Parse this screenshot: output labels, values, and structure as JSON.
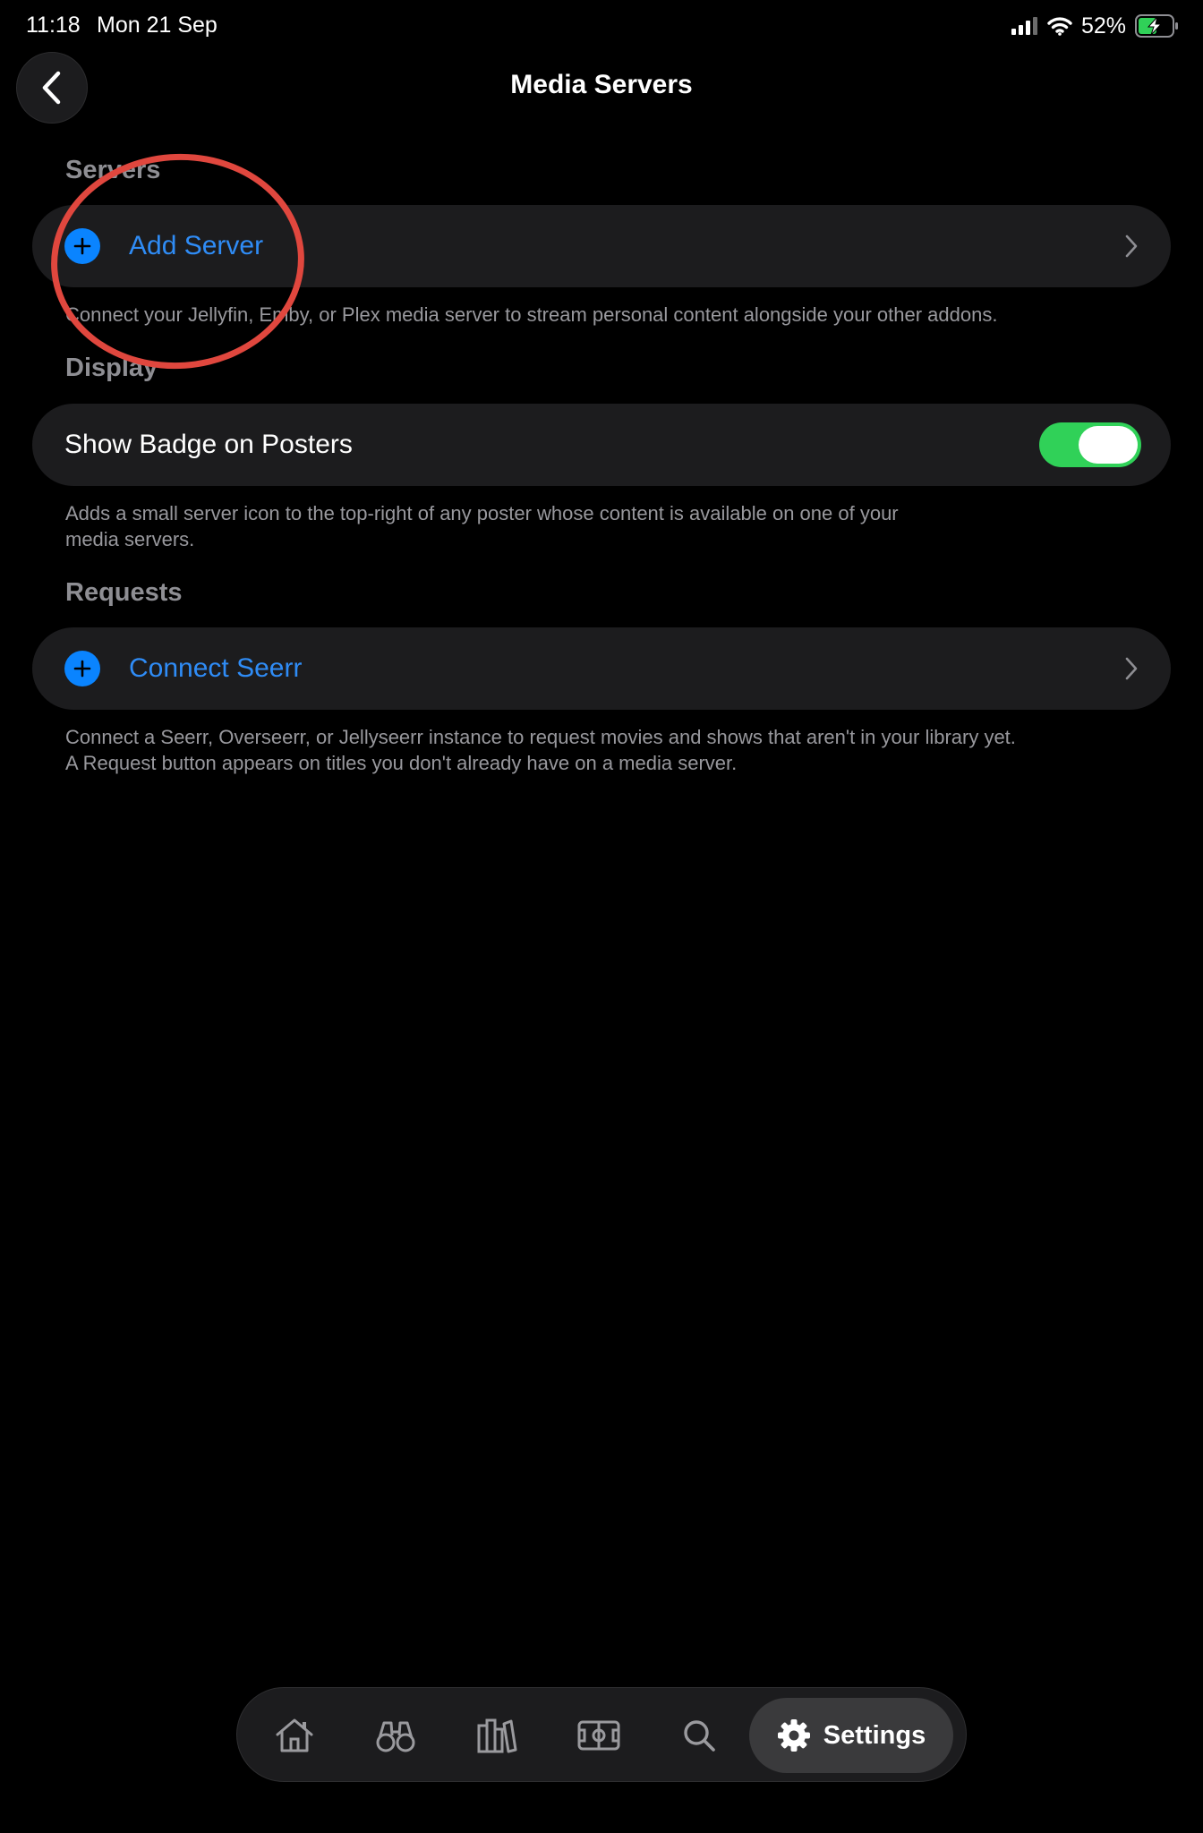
{
  "status_bar": {
    "time": "11:18",
    "date": "Mon 21 Sep",
    "battery_percent": "52%",
    "icons": [
      "cellular-signal-icon",
      "wifi-icon",
      "battery-charging-icon"
    ]
  },
  "header": {
    "back_icon": "chevron-left-icon",
    "title": "Media Servers"
  },
  "sections": {
    "servers": {
      "header": "Servers",
      "row_label": "Add Server",
      "row_icon": "plus-circle-icon",
      "description": "Connect your Jellyfin, Emby, or Plex media server to stream personal content alongside your other addons."
    },
    "display": {
      "header": "Display",
      "row_label": "Show Badge on Posters",
      "toggle_on": true,
      "description_line1": "Adds a small server icon to the top-right of any poster whose content is available on one of your",
      "description_line2": "media servers."
    },
    "requests": {
      "header": "Requests",
      "row_label": "Connect Seerr",
      "row_icon": "plus-circle-icon",
      "description_line1": "Connect a Seerr, Overseerr, or Jellyseerr instance to request movies and shows that aren't in your library yet.",
      "description_line2": "A Request button appears on titles you don't already have on a media server."
    }
  },
  "tab_bar": {
    "tabs": [
      {
        "icon": "home-icon"
      },
      {
        "icon": "binoculars-icon"
      },
      {
        "icon": "library-icon"
      },
      {
        "icon": "stadium-icon"
      },
      {
        "icon": "search-icon"
      }
    ],
    "active_tab": {
      "icon": "gear-icon",
      "label": "Settings"
    }
  },
  "colors": {
    "accent_blue": "#2f8cf6",
    "toggle_green": "#30d158",
    "annotation_red": "#e0473e",
    "row_background": "#1c1c1e"
  }
}
